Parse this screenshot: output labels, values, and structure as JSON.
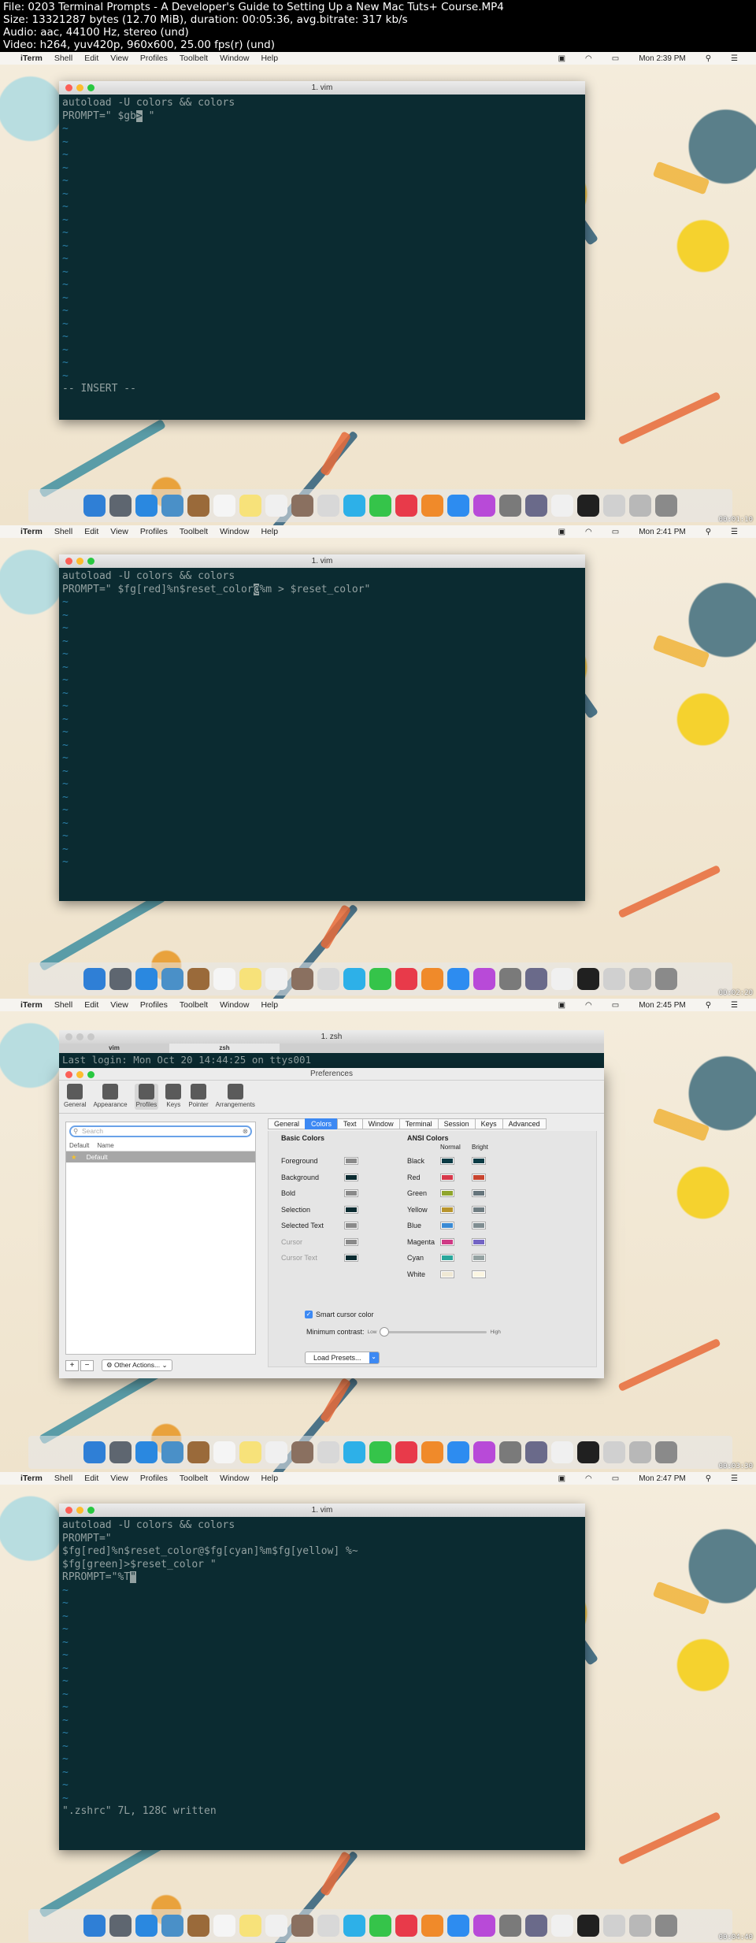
{
  "header": {
    "lines": [
      "File: 0203 Terminal Prompts - A Developer's Guide to Setting Up a New Mac Tuts+ Course.MP4",
      "Size: 13321287 bytes (12.70 MiB), duration: 00:05:36, avg.bitrate: 317 kb/s",
      "Audio: aac, 44100 Hz, stereo (und)",
      "Video: h264, yuv420p, 960x600, 25.00 fps(r) (und)"
    ]
  },
  "menubar": {
    "apple": "",
    "app": "iTerm",
    "items": [
      "Shell",
      "Edit",
      "View",
      "Profiles",
      "Toolbelt",
      "Window",
      "Help"
    ]
  },
  "frames": [
    {
      "clock": "Mon 2:39 PM",
      "stamp": "00:01:10",
      "title": "1. vim",
      "lines": [
        "autoload -U colors && colors",
        "",
        "PROMPT=\" $gb",
        "~",
        "~",
        "~",
        "~",
        "~",
        "~",
        "~",
        "~",
        "~",
        "~",
        "~",
        "~",
        "~",
        "~",
        "~",
        "~",
        "~",
        "~",
        "~",
        "~",
        "-- INSERT --"
      ],
      "cursor_line_suffix": "> \""
    },
    {
      "clock": "Mon 2:41 PM",
      "stamp": "00:02:20",
      "title": "1. vim",
      "lines": [
        "autoload -U colors && colors",
        "",
        "PROMPT=\" $fg[red]%n$reset_color",
        "~",
        "~",
        "~",
        "~",
        "~",
        "~",
        "~",
        "~",
        "~",
        "~",
        "~",
        "~",
        "~",
        "~",
        "~",
        "~",
        "~",
        "~",
        "~",
        "~",
        "~"
      ],
      "cursor_char": "@",
      "after_cursor": "%m > $reset_color\""
    },
    {
      "clock": "Mon 2:45 PM",
      "stamp": "00:03:30"
    },
    {
      "clock": "Mon 2:47 PM",
      "stamp": "00:04:40",
      "title": "1. vim",
      "lines": [
        "autoload -U colors && colors",
        "",
        "PROMPT=\"",
        "$fg[red]%n$reset_color@$fg[cyan]%m$fg[yellow] %~",
        "$fg[green]>$reset_color \"",
        "",
        "RPROMPT=\"%T",
        "~",
        "~",
        "~",
        "~",
        "~",
        "~",
        "~",
        "~",
        "~",
        "~",
        "~",
        "~",
        "~",
        "~",
        "~",
        "~",
        "~",
        "\".zshrc\" 7L, 128C written"
      ],
      "cursor_char": "\""
    }
  ],
  "iterm": {
    "tabs": [
      "vim",
      "zsh"
    ],
    "last_login": "Last login: Mon Oct 20 14:44:25 on ttys001",
    "prefs_title": "Preferences",
    "toolbar": [
      "General",
      "Appearance",
      "Profiles",
      "Keys",
      "Pointer",
      "Arrangements"
    ],
    "search_placeholder": "Search",
    "list_headers": [
      "Default",
      "Name"
    ],
    "profile": "Default",
    "other_actions": "Other Actions...",
    "tabs_right": [
      "General",
      "Colors",
      "Text",
      "Window",
      "Terminal",
      "Session",
      "Keys",
      "Advanced"
    ],
    "basic_title": "Basic Colors",
    "basic": [
      {
        "label": "Foreground",
        "color": "#8a8a8a",
        "disabled": false
      },
      {
        "label": "Background",
        "color": "#0b2b31",
        "disabled": false
      },
      {
        "label": "Bold",
        "color": "#8a8a8a",
        "disabled": false
      },
      {
        "label": "Selection",
        "color": "#0b2b31",
        "disabled": false
      },
      {
        "label": "Selected Text",
        "color": "#8a8a8a",
        "disabled": false
      },
      {
        "label": "Cursor",
        "color": "#8a8a8a",
        "disabled": true
      },
      {
        "label": "Cursor Text",
        "color": "#0b2b31",
        "disabled": true
      }
    ],
    "ansi_title": "ANSI Colors",
    "ansi_cols": [
      "Normal",
      "Bright"
    ],
    "ansi": [
      {
        "label": "Black",
        "normal": "#0b3b45",
        "bright": "#0b3b45"
      },
      {
        "label": "Red",
        "normal": "#d7384a",
        "bright": "#c8442f"
      },
      {
        "label": "Green",
        "normal": "#90a52d",
        "bright": "#65747b"
      },
      {
        "label": "Yellow",
        "normal": "#b8952d",
        "bright": "#6f7d82"
      },
      {
        "label": "Blue",
        "normal": "#3a8ad4",
        "bright": "#7f8d91"
      },
      {
        "label": "Magenta",
        "normal": "#cf3a85",
        "bright": "#7364c4"
      },
      {
        "label": "Cyan",
        "normal": "#2aa79b",
        "bright": "#94a2a2"
      },
      {
        "label": "White",
        "normal": "#efe8d4",
        "bright": "#fcf6e2"
      }
    ],
    "smart_cursor": "Smart cursor color",
    "min_contrast": "Minimum contrast:",
    "low": "Low",
    "high": "High",
    "load_presets": "Load Presets..."
  }
}
